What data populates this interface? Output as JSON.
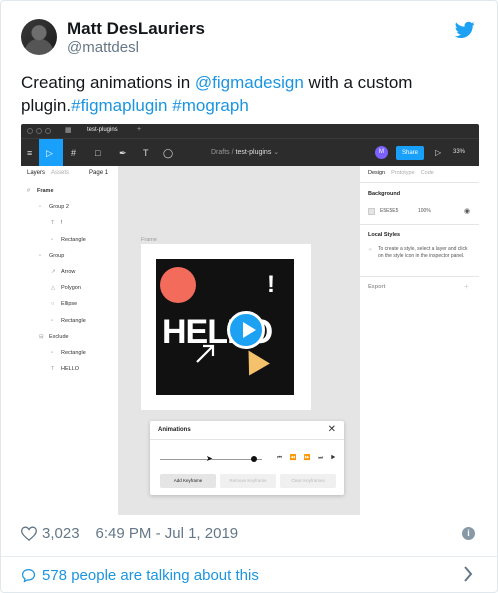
{
  "author": {
    "name": "Matt DesLauriers",
    "handle": "@mattdesl"
  },
  "tweet": {
    "text_prefix": "Creating animations in ",
    "mention": "@figmadesign",
    "text_middle": " with a custom plugin.",
    "hashtag1": "#figmaplugin",
    "hashtag2": "#mograph"
  },
  "figma": {
    "tab_name": "test-plugins",
    "breadcrumb_drafts": "Drafts",
    "breadcrumb_sep": "/",
    "breadcrumb_file": "test-plugins",
    "user_initial": "M",
    "share_label": "Share",
    "zoom": "33%",
    "left_tabs": [
      "Layers",
      "Assets",
      "Page 1"
    ],
    "layers": [
      {
        "icon": "#",
        "label": "Frame",
        "indent": 0
      },
      {
        "icon": "▫",
        "label": "Group 2",
        "indent": 1
      },
      {
        "icon": "T",
        "label": "!",
        "indent": 2
      },
      {
        "icon": "▫",
        "label": "Rectangle",
        "indent": 2
      },
      {
        "icon": "▫",
        "label": "Group",
        "indent": 1
      },
      {
        "icon": "↗",
        "label": "Arrow",
        "indent": 2
      },
      {
        "icon": "△",
        "label": "Polygon",
        "indent": 2
      },
      {
        "icon": "○",
        "label": "Ellipse",
        "indent": 2
      },
      {
        "icon": "▫",
        "label": "Rectangle",
        "indent": 2
      },
      {
        "icon": "⊟",
        "label": "Exclude",
        "indent": 1
      },
      {
        "icon": "▫",
        "label": "Rectangle",
        "indent": 2
      },
      {
        "icon": "T",
        "label": "HELLO",
        "indent": 2
      }
    ],
    "frame_label": "Frame",
    "canvas_text": "HELLO",
    "canvas_excl": "!",
    "right_tabs": [
      "Design",
      "Prototype",
      "Code"
    ],
    "background_heading": "Background",
    "background_hex": "E5E5E5",
    "background_opacity": "100%",
    "local_styles_heading": "Local Styles",
    "local_styles_text": "To create a style, select a layer and click on the style icon in the inspector panel.",
    "export_heading": "Export",
    "animations_title": "Animations",
    "close": "✕",
    "transport": "⏮ ⏪ ⏩ ⏭ ▶",
    "add_keyframe": "Add Keyframe",
    "remove_keyframe": "Remove Keyframe",
    "clear_keyframes": "Clear Keyframes",
    "help": "?"
  },
  "meta": {
    "likes": "3,023",
    "timestamp": "6:49 PM - Jul 1, 2019"
  },
  "footer": {
    "talking": "578 people are talking about this"
  },
  "colors": {
    "link": "#1b95e0",
    "figma_blue": "#18a0fb",
    "coral": "#f26b5b",
    "yellow": "#f5c26b"
  }
}
